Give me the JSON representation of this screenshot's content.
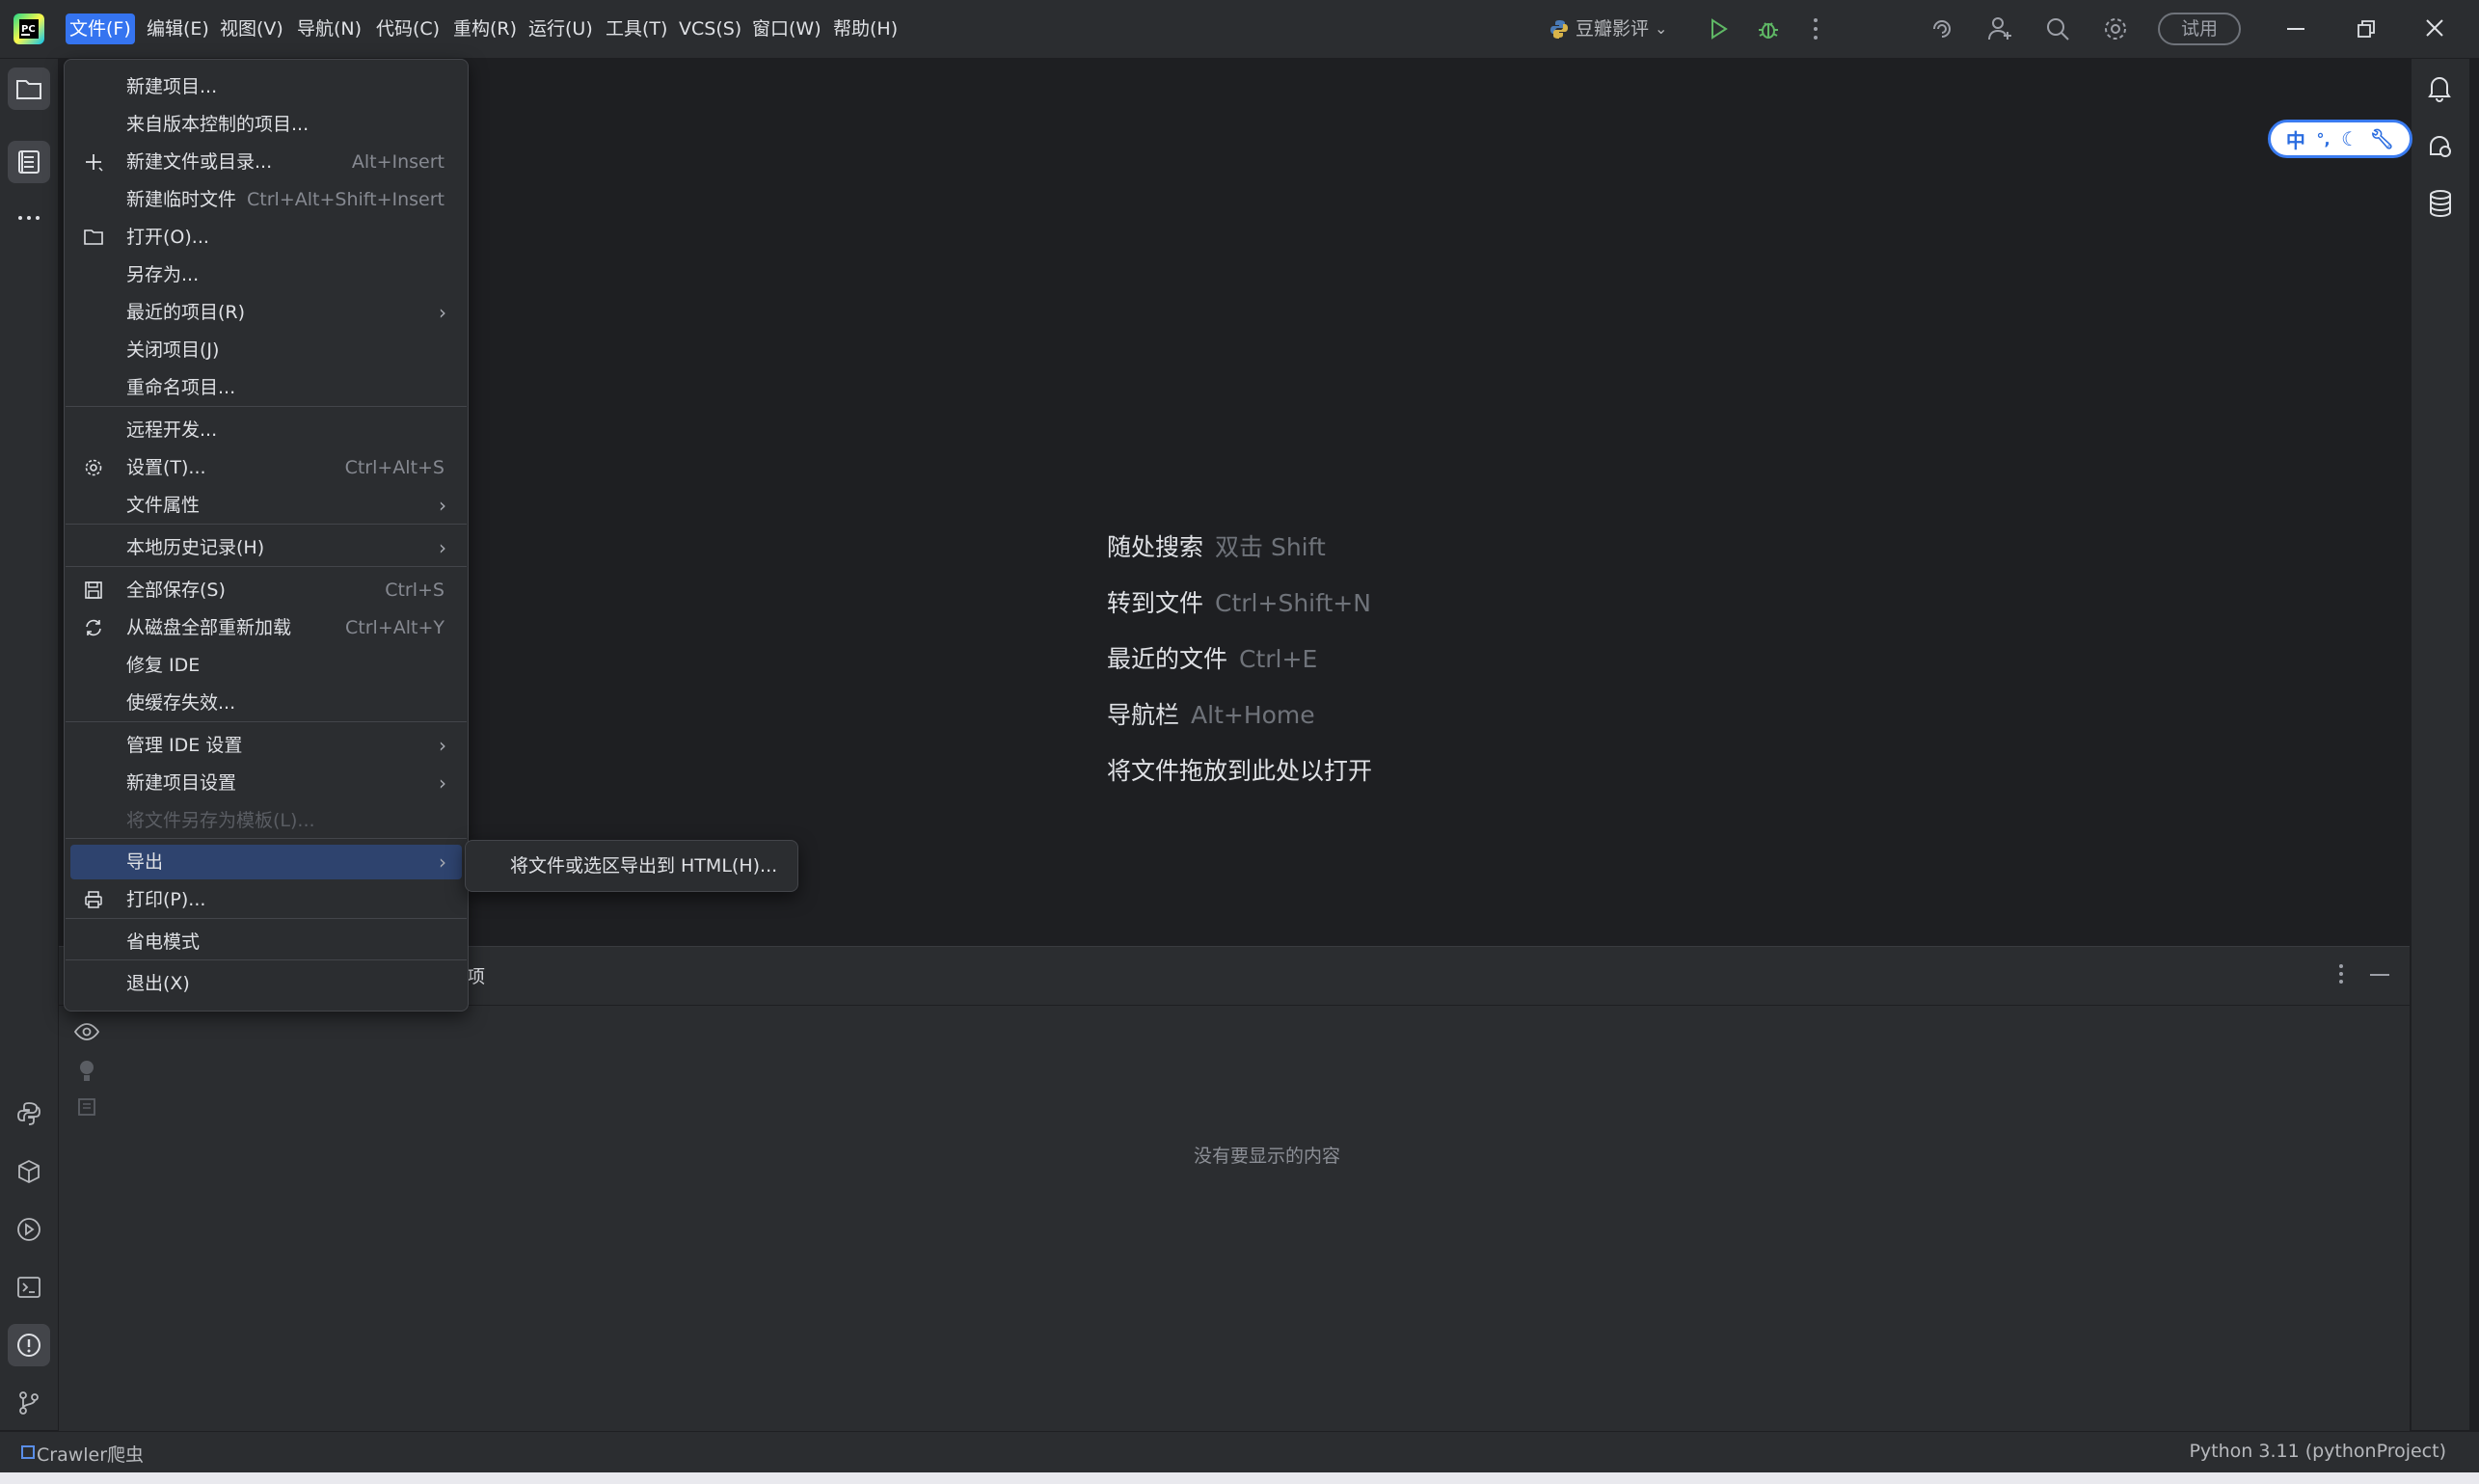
{
  "menubar": {
    "items": [
      "文件(F)",
      "编辑(E)",
      "视图(V)",
      "导航(N)",
      "代码(C)",
      "重构(R)",
      "运行(U)",
      "工具(T)",
      "VCS(S)",
      "窗口(W)",
      "帮助(H)"
    ],
    "active_index": 0
  },
  "toolbar": {
    "run_config": "豆瓣影评",
    "trial_label": "试用"
  },
  "file_menu": {
    "items": [
      {
        "label": "新建项目...",
        "shortcut": "",
        "icon": "",
        "submenu": false,
        "disabled": false
      },
      {
        "label": "来自版本控制的项目...",
        "shortcut": "",
        "icon": "",
        "submenu": false,
        "disabled": false
      },
      {
        "label": "新建文件或目录...",
        "shortcut": "Alt+Insert",
        "icon": "plus-icon",
        "submenu": false,
        "disabled": false
      },
      {
        "label": "新建临时文件",
        "shortcut": "Ctrl+Alt+Shift+Insert",
        "icon": "",
        "submenu": false,
        "disabled": false
      },
      {
        "label": "打开(O)...",
        "shortcut": "",
        "icon": "folder-icon",
        "submenu": false,
        "disabled": false
      },
      {
        "label": "另存为...",
        "shortcut": "",
        "icon": "",
        "submenu": false,
        "disabled": false
      },
      {
        "label": "最近的项目(R)",
        "shortcut": "",
        "icon": "",
        "submenu": true,
        "disabled": false
      },
      {
        "label": "关闭项目(J)",
        "shortcut": "",
        "icon": "",
        "submenu": false,
        "disabled": false
      },
      {
        "label": "重命名项目...",
        "shortcut": "",
        "icon": "",
        "submenu": false,
        "disabled": false
      },
      {
        "label": "远程开发...",
        "shortcut": "",
        "icon": "",
        "submenu": false,
        "disabled": false
      },
      {
        "label": "设置(T)...",
        "shortcut": "Ctrl+Alt+S",
        "icon": "gear-icon",
        "submenu": false,
        "disabled": false
      },
      {
        "label": "文件属性",
        "shortcut": "",
        "icon": "",
        "submenu": true,
        "disabled": false
      },
      {
        "label": "本地历史记录(H)",
        "shortcut": "",
        "icon": "",
        "submenu": true,
        "disabled": false
      },
      {
        "label": "全部保存(S)",
        "shortcut": "Ctrl+S",
        "icon": "save-icon",
        "submenu": false,
        "disabled": false
      },
      {
        "label": "从磁盘全部重新加载",
        "shortcut": "Ctrl+Alt+Y",
        "icon": "reload-icon",
        "submenu": false,
        "disabled": false
      },
      {
        "label": "修复 IDE",
        "shortcut": "",
        "icon": "",
        "submenu": false,
        "disabled": false
      },
      {
        "label": "使缓存失效...",
        "shortcut": "",
        "icon": "",
        "submenu": false,
        "disabled": false
      },
      {
        "label": "管理 IDE 设置",
        "shortcut": "",
        "icon": "",
        "submenu": true,
        "disabled": false
      },
      {
        "label": "新建项目设置",
        "shortcut": "",
        "icon": "",
        "submenu": true,
        "disabled": false
      },
      {
        "label": "将文件另存为模板(L)...",
        "shortcut": "",
        "icon": "",
        "submenu": false,
        "disabled": true
      },
      {
        "label": "导出",
        "shortcut": "",
        "icon": "",
        "submenu": true,
        "disabled": false,
        "highlighted": true
      },
      {
        "label": "打印(P)...",
        "shortcut": "",
        "icon": "print-icon",
        "submenu": false,
        "disabled": false
      },
      {
        "label": "省电模式",
        "shortcut": "",
        "icon": "",
        "submenu": false,
        "disabled": false
      },
      {
        "label": "退出(X)",
        "shortcut": "",
        "icon": "",
        "submenu": false,
        "disabled": false
      }
    ]
  },
  "export_submenu": {
    "item": "将文件或选区导出到 HTML(H)..."
  },
  "editor_hints": [
    {
      "label": "随处搜索",
      "key": "双击 Shift"
    },
    {
      "label": "转到文件",
      "key": "Ctrl+Shift+N"
    },
    {
      "label": "最近的文件",
      "key": "Ctrl+E"
    },
    {
      "label": "导航栏",
      "key": "Alt+Home"
    },
    {
      "label": "将文件拖放到此处以打开",
      "key": ""
    }
  ],
  "ime": {
    "label": "中"
  },
  "bottom_panel": {
    "tab_fragment": "项",
    "empty_text": "没有要显示的内容"
  },
  "statusbar": {
    "project": "Crawler爬虫",
    "interpreter": "Python 3.11 (pythonProject)"
  },
  "colors": {
    "accent": "#3574f0",
    "menu_highlight": "#2e436e",
    "background": "#1e1f22",
    "panel": "#2b2d30",
    "run_green": "#5fb865"
  }
}
